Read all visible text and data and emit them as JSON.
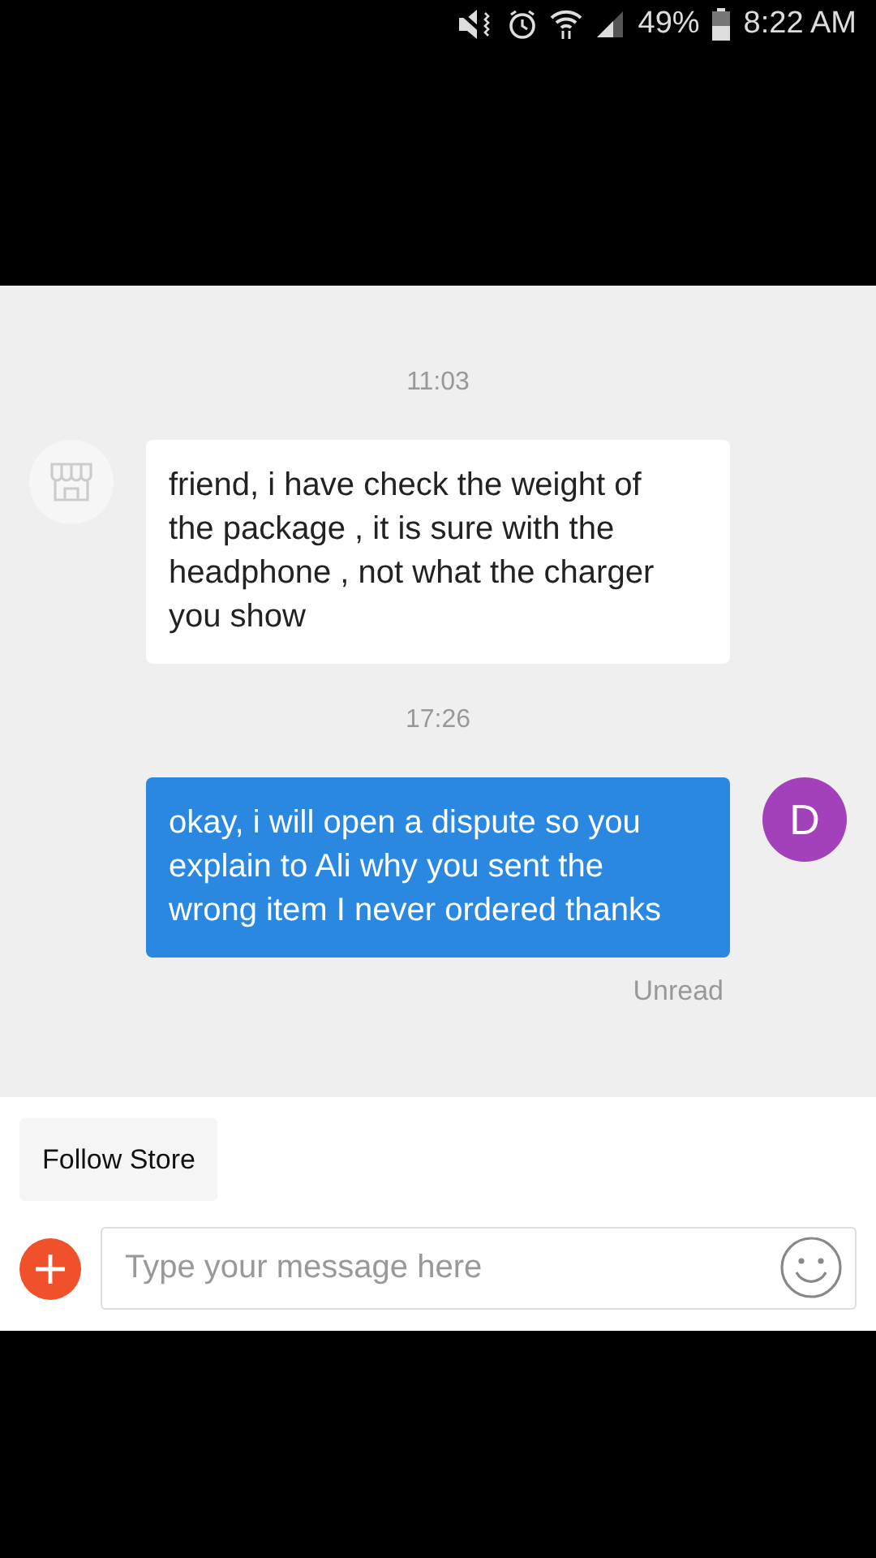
{
  "status_bar": {
    "battery": "49%",
    "time": "8:22 AM"
  },
  "messages": [
    {
      "kind": "received",
      "time": "11:03",
      "text": "friend, i have check the weight of the package , it  is sure with the headphone , not what the charger you show"
    },
    {
      "kind": "sent",
      "time": "17:26",
      "avatar": "D",
      "text": "okay, i will open a dispute so you explain to Ali why you sent the wrong item I never ordered thanks",
      "status": "Unread"
    }
  ],
  "follow_button": "Follow Store",
  "composer": {
    "placeholder": "Type your message here"
  }
}
